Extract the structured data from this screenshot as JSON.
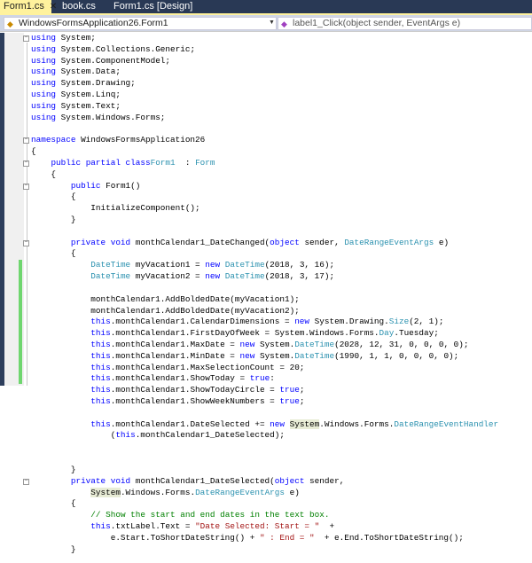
{
  "tabs": [
    {
      "label": "Form1.cs",
      "close": "✕",
      "active": true
    },
    {
      "label": "book.cs"
    },
    {
      "label": "Form1.cs [Design]"
    }
  ],
  "nav": {
    "class_dropdown": "WindowsFormsApplication26.Form1",
    "member_dropdown": "label1_Click(object sender, EventArgs e)",
    "class_icon": "class-icon",
    "member_icon": "method-icon"
  },
  "colors": {
    "keyword": "#0000ff",
    "type": "#2b91af",
    "string": "#a31515",
    "comment": "#008000",
    "tabbar": "#293955",
    "active_tab": "#fff29d"
  },
  "code": [
    [
      [
        "kw",
        "using"
      ],
      [
        "",
        "System;"
      ]
    ],
    [
      [
        "kw",
        "using"
      ],
      [
        "",
        "System.Collections.Generic;"
      ]
    ],
    [
      [
        "kw",
        "using"
      ],
      [
        "",
        "System.ComponentModel;"
      ]
    ],
    [
      [
        "kw",
        "using"
      ],
      [
        "",
        "System.Data;"
      ]
    ],
    [
      [
        "kw",
        "using"
      ],
      [
        "",
        "System.Drawing;"
      ]
    ],
    [
      [
        "kw",
        "using"
      ],
      [
        "",
        "System.Linq;"
      ]
    ],
    [
      [
        "kw",
        "using"
      ],
      [
        "",
        "System.Text;"
      ]
    ],
    [
      [
        "kw",
        "using"
      ],
      [
        "",
        "System.Windows.Forms;"
      ]
    ],
    [],
    [
      [
        "kw",
        "namespace"
      ],
      [
        "",
        "WindowsFormsApplication26"
      ]
    ],
    [
      [
        "",
        "{"
      ]
    ],
    [
      [
        "",
        "    "
      ],
      [
        "kw",
        "public partial class"
      ],
      [
        "",
        ""
      ],
      [
        "ty",
        "Form1"
      ],
      [
        "",
        " :"
      ],
      [
        "ty",
        "Form"
      ]
    ],
    [
      [
        "",
        "    {"
      ]
    ],
    [
      [
        "",
        "        "
      ],
      [
        "kw",
        "public"
      ],
      [
        "",
        "Form1()"
      ]
    ],
    [
      [
        "",
        "        {"
      ]
    ],
    [
      [
        "",
        "            InitializeComponent();"
      ]
    ],
    [
      [
        "",
        "        }"
      ]
    ],
    [],
    [
      [
        "",
        "        "
      ],
      [
        "kw",
        "private void"
      ],
      [
        "",
        "monthCalendar1_DateChanged("
      ],
      [
        "kw",
        "object"
      ],
      [
        "",
        "sender,"
      ],
      [
        "ty",
        "DateRangeEventArgs"
      ],
      [
        "",
        "e)"
      ]
    ],
    [
      [
        "",
        "        {"
      ]
    ],
    [
      [
        "",
        "            "
      ],
      [
        "ty",
        "DateTime"
      ],
      [
        "",
        "myVacation1 ="
      ],
      [
        "kw",
        "new"
      ],
      [
        "ty",
        "DateTime"
      ],
      [
        "",
        "(2018, 3, 16);"
      ]
    ],
    [
      [
        "",
        "            "
      ],
      [
        "ty",
        "DateTime"
      ],
      [
        "",
        "myVacation2 ="
      ],
      [
        "kw",
        "new"
      ],
      [
        "ty",
        "DateTime"
      ],
      [
        "",
        "(2018, 3, 17);"
      ]
    ],
    [],
    [
      [
        "",
        "            monthCalendar1.AddBoldedDate(myVacation1);"
      ]
    ],
    [
      [
        "",
        "            monthCalendar1.AddBoldedDate(myVacation2);"
      ]
    ],
    [
      [
        "",
        "            "
      ],
      [
        "kw",
        "this"
      ],
      [
        "",
        ".monthCalendar1.CalendarDimensions = "
      ],
      [
        "kw",
        "new"
      ],
      [
        "",
        "System.Drawing."
      ],
      [
        "ty",
        "Size"
      ],
      [
        "",
        "(2, 1);"
      ]
    ],
    [
      [
        "",
        "            "
      ],
      [
        "kw",
        "this"
      ],
      [
        "",
        ".monthCalendar1.FirstDayOfWeek = System.Windows.Forms."
      ],
      [
        "ty",
        "Day"
      ],
      [
        "",
        ".Tuesday;"
      ]
    ],
    [
      [
        "",
        "            "
      ],
      [
        "kw",
        "this"
      ],
      [
        "",
        ".monthCalendar1.MaxDate = "
      ],
      [
        "kw",
        "new"
      ],
      [
        "",
        "System."
      ],
      [
        "ty",
        "DateTime"
      ],
      [
        "",
        "(2028, 12, 31, 0, 0, 0, 0);"
      ]
    ],
    [
      [
        "",
        "            "
      ],
      [
        "kw",
        "this"
      ],
      [
        "",
        ".monthCalendar1.MinDate = "
      ],
      [
        "kw",
        "new"
      ],
      [
        "",
        "System."
      ],
      [
        "ty",
        "DateTime"
      ],
      [
        "",
        "(1990, 1, 1, 0, 0, 0, 0);"
      ]
    ],
    [
      [
        "",
        "            "
      ],
      [
        "kw",
        "this"
      ],
      [
        "",
        ".monthCalendar1.MaxSelectionCount = 20;"
      ]
    ],
    [
      [
        "",
        "            "
      ],
      [
        "kw",
        "this"
      ],
      [
        "",
        ".monthCalendar1.ShowToday = "
      ],
      [
        "kw",
        "true"
      ],
      [
        "",
        ":"
      ]
    ],
    [
      [
        "",
        "            "
      ],
      [
        "kw",
        "this"
      ],
      [
        "",
        ".monthCalendar1.ShowTodayCircle = "
      ],
      [
        "kw",
        "true"
      ],
      [
        "",
        ";"
      ]
    ],
    [
      [
        "",
        "            "
      ],
      [
        "kw",
        "this"
      ],
      [
        "",
        ".monthCalendar1.ShowWeekNumbers = "
      ],
      [
        "kw",
        "true"
      ],
      [
        "",
        ";"
      ]
    ],
    [],
    [
      [
        "",
        "            "
      ],
      [
        "kw",
        "this"
      ],
      [
        "",
        ".monthCalendar1.DateSelected += "
      ],
      [
        "kw",
        "new"
      ],
      [
        "hl",
        "System"
      ],
      [
        "",
        ".Windows.Forms."
      ],
      [
        "ty",
        "DateRangeEventHandler"
      ]
    ],
    [
      [
        "",
        "                ("
      ],
      [
        "kw",
        "this"
      ],
      [
        "",
        ".monthCalendar1_DateSelected);"
      ]
    ],
    [],
    [],
    [
      [
        "",
        "        }"
      ]
    ],
    [
      [
        "",
        "        "
      ],
      [
        "kw",
        "private void"
      ],
      [
        "",
        "monthCalendar1_DateSelected("
      ],
      [
        "kw",
        "object"
      ],
      [
        "",
        "sender,"
      ]
    ],
    [
      [
        "",
        "            "
      ],
      [
        "hl",
        "System"
      ],
      [
        "",
        ".Windows.Forms."
      ],
      [
        "ty",
        "DateRangeEventArgs"
      ],
      [
        "",
        "e)"
      ]
    ],
    [
      [
        "",
        "        {"
      ]
    ],
    [
      [
        "",
        "            "
      ],
      [
        "cm",
        "// Show the start and end dates in the text box."
      ]
    ],
    [
      [
        "",
        "            "
      ],
      [
        "kw",
        "this"
      ],
      [
        "",
        ".txtLabel.Text = "
      ],
      [
        "st",
        "\"Date Selected: Start = \""
      ],
      [
        "",
        " +"
      ]
    ],
    [
      [
        "",
        "                e.Start.ToShortDateString() + "
      ],
      [
        "st",
        "\" : End = \""
      ],
      [
        "",
        " + e.End.ToShortDateString();"
      ]
    ],
    [
      [
        "",
        "        }"
      ]
    ]
  ]
}
